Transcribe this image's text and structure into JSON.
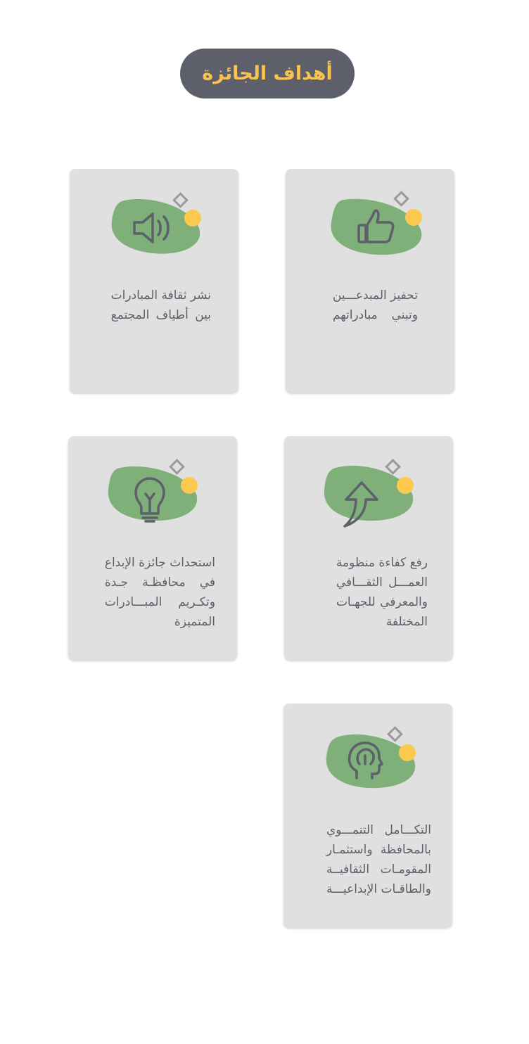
{
  "header": {
    "title": "أهداف الجائزة"
  },
  "colors": {
    "pill_background": "#5d5f6b",
    "title_text": "#f8c44f",
    "card_background": "#e0e0e0",
    "blob_green": "#7fb07a",
    "dot_yellow": "#fcc94f",
    "diamond_gray": "#9a9a9a",
    "icon_stroke": "#5d5f6b",
    "body_text": "#5d5f6b"
  },
  "goals": [
    {
      "icon": "thumbs-up-icon",
      "lines": [
        "تحفيز المبدعـــين",
        "وتبني مبادراتهم"
      ]
    },
    {
      "icon": "megaphone-icon",
      "lines": [
        "نشر ثقافة المبادرات",
        "بين أطياف المجتمع"
      ]
    },
    {
      "icon": "growth-arrow-icon",
      "lines": [
        "رفع كفاءة منظومة",
        "العمـــل الثقـــافي",
        "والمعرفي للجهـات",
        "المختلفة"
      ]
    },
    {
      "icon": "lightbulb-icon",
      "lines": [
        "استحداث جائزة الإبداع",
        "في محافظـة جـدة",
        "وتكـريم المبـــادرات",
        "المتميزة"
      ]
    },
    {
      "icon": "head-brain-icon",
      "lines": [
        "التكـــامل التنمـــوي",
        "بالمحافظة واستثمـار",
        "المقومـات الثقافيــة",
        "والطاقـات الإبداعيـــة"
      ]
    }
  ]
}
